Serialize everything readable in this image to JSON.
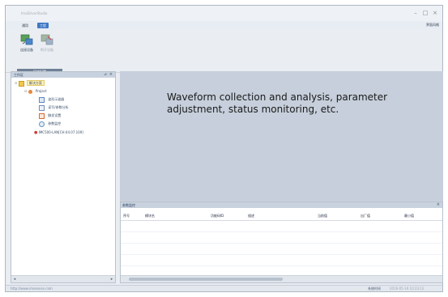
{
  "window": {
    "title": "ImxDriverStudio"
  },
  "menubar": {
    "menus": [
      "通用",
      "工程"
    ],
    "right": "界面风格"
  },
  "ribbon": {
    "buttons": [
      {
        "label": "连接设备",
        "icon": "connect-device-icon",
        "enabled": true
      },
      {
        "label": "断开设备",
        "icon": "disconnect-device-icon",
        "enabled": false
      }
    ],
    "group_label": "网络配置"
  },
  "sidebar": {
    "title": "工作区",
    "root": "解决方案",
    "project": "Project",
    "items": [
      {
        "label": "波形示波器",
        "icon": "oscilloscope-icon"
      },
      {
        "label": "读写/参数分析",
        "icon": "read-write-icon"
      },
      {
        "label": "触发设置",
        "icon": "trigger-settings-icon"
      },
      {
        "label": "参数监控",
        "icon": "parameter-monitor-icon"
      }
    ],
    "device": "IMC500-LAN[CH:44.07.109]"
  },
  "main": {
    "banner": "Waveform collection and analysis, parameter adjustment, status monitoring, etc."
  },
  "bottom": {
    "title": "参数监控",
    "columns": [
      "序号",
      "模块名",
      "功能码ID",
      "描述",
      "当前值",
      "出厂值",
      "最小值"
    ]
  },
  "statusbar": {
    "url": "http://www.imxsense.com",
    "label": "系统时间",
    "time": "2016-05-19 10:23:12"
  },
  "colors": {
    "accent": "#3d77c4",
    "workspace": "#c6cfdb",
    "panel_header": "#c8d2de"
  }
}
